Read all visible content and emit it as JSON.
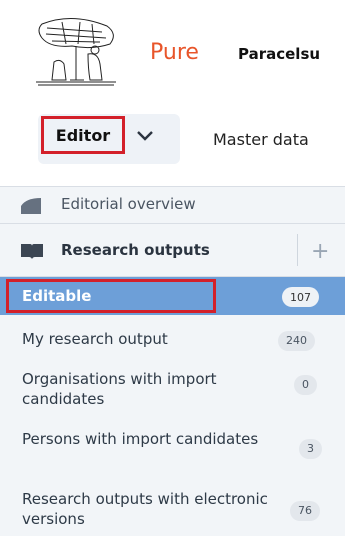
{
  "header": {
    "app_name": "Pure",
    "organisation": "Paracelsu"
  },
  "menu": {
    "editor_label": "Editor",
    "master_data_label": "Master data"
  },
  "sidebar": {
    "editorial_overview": "Editorial overview",
    "research_outputs": "Research outputs",
    "items": [
      {
        "label": "Editable",
        "count": "107"
      },
      {
        "label": "My research output",
        "count": "240"
      },
      {
        "label": "Organisations with import candidates",
        "count": "0"
      },
      {
        "label": "Persons with import candidates",
        "count": "3"
      },
      {
        "label": "Research outputs with electronic versions",
        "count": "76"
      }
    ]
  },
  "colors": {
    "brand": "#e8552a",
    "selected": "#6d9fd8",
    "highlight_box": "#d3202a"
  }
}
